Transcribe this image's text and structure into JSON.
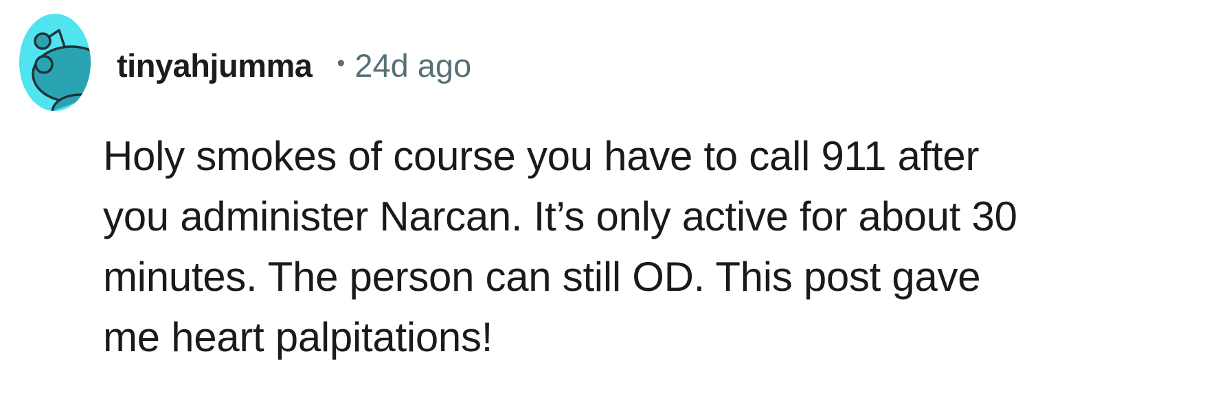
{
  "comment": {
    "author": "tinyahjumma",
    "separator": "•",
    "age": "24d ago",
    "body_lines": [
      "Holy smokes of course you have to call 911 after",
      "you administer Narcan. It’s only active for about 30",
      "minutes. The person can still OD. This post gave",
      "me heart palpitations!"
    ],
    "avatar_icon": "reddit-snoo-default-avatar-icon",
    "colors": {
      "avatar_background": "#50e3f0",
      "avatar_figure": "#2aa4b2",
      "username": "#1c1c1c",
      "meta": "#576f76",
      "body": "#1a1a1b"
    }
  }
}
